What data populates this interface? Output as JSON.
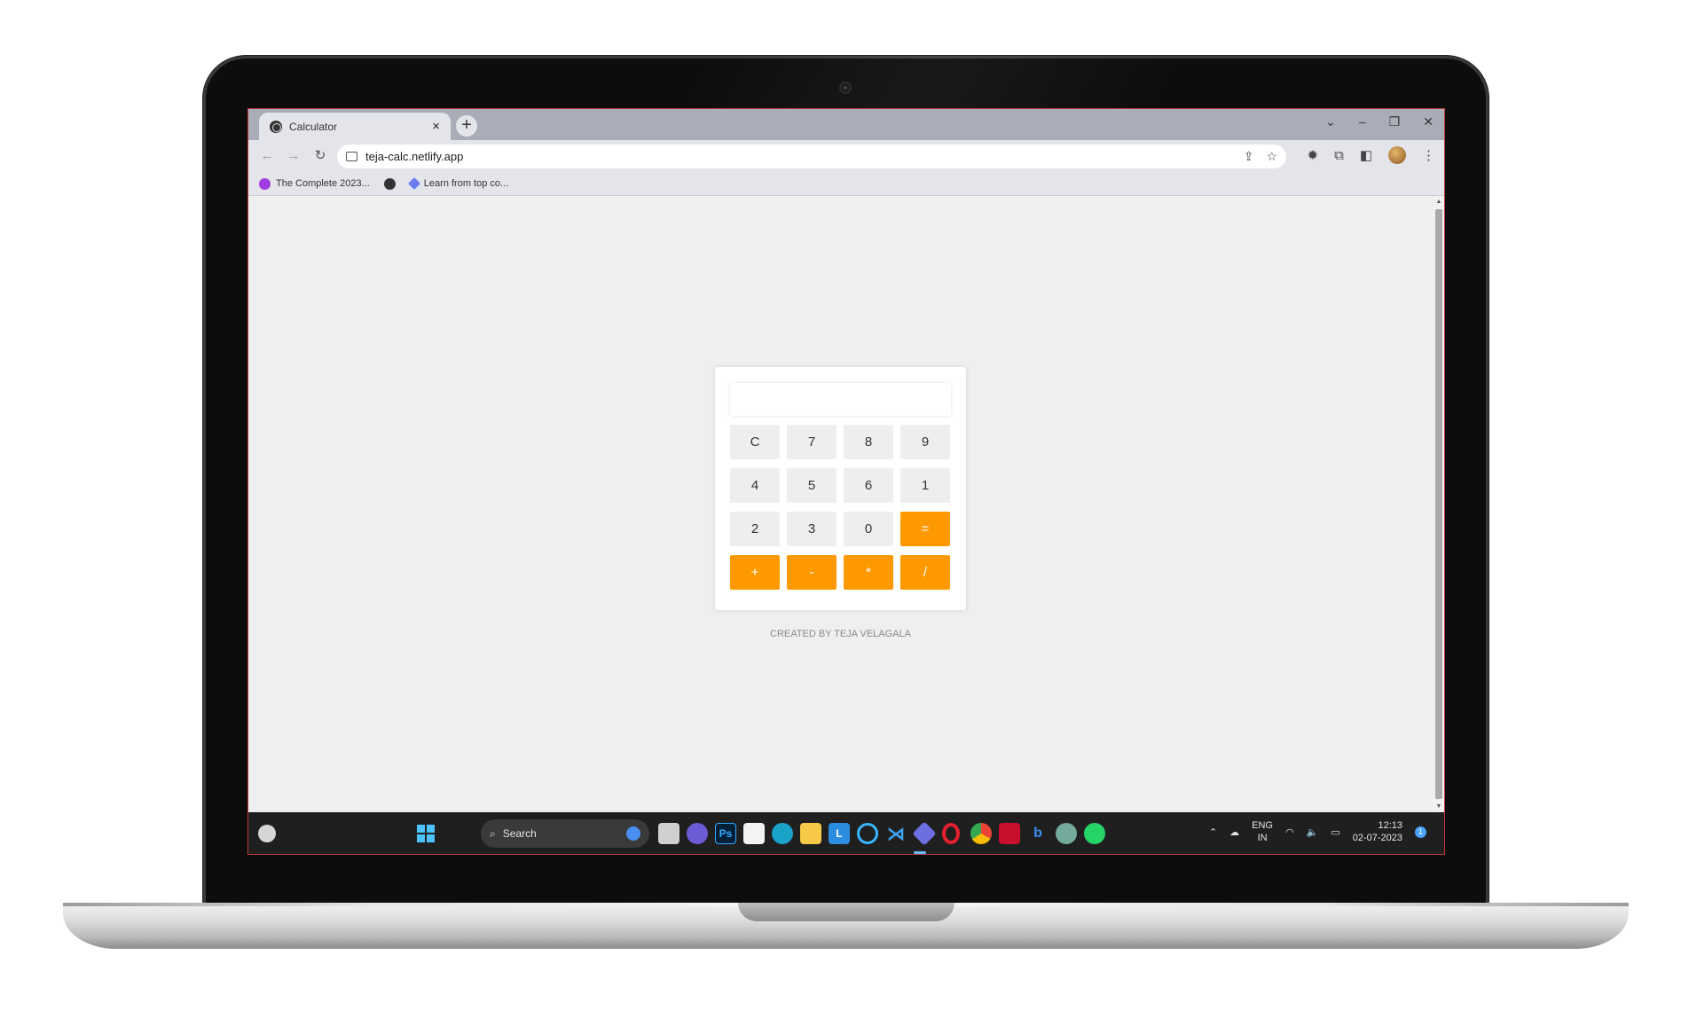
{
  "browser": {
    "tab_title": "Calculator",
    "tab_close": "×",
    "new_tab": "+",
    "url": "teja-calc.netlify.app",
    "bookmarks": [
      "The Complete 2023...",
      "Learn from top co..."
    ]
  },
  "calculator": {
    "display_value": "",
    "keys": [
      "C",
      "7",
      "8",
      "9",
      "4",
      "5",
      "6",
      "1",
      "2",
      "3",
      "0",
      "=",
      "+",
      "-",
      "*",
      "/"
    ],
    "operator_color": "#ff9900"
  },
  "credit": "CREATED BY TEJA VELAGALA",
  "taskbar": {
    "search_placeholder": "Search",
    "lang": "ENG",
    "region": "IN",
    "time": "12:13",
    "date": "02-07-2023",
    "notification_count": "1",
    "apps": [
      "start-icon",
      "task-view-icon",
      "meet-icon",
      "photoshop-icon",
      "store-icon",
      "edge-icon",
      "explorer-icon",
      "l-app-icon",
      "cortana-icon",
      "vscode-icon",
      "powerautomate-icon",
      "opera-icon",
      "chrome-icon",
      "mcafee-icon",
      "bing-icon",
      "chatgpt-icon",
      "whatsapp-icon"
    ]
  }
}
